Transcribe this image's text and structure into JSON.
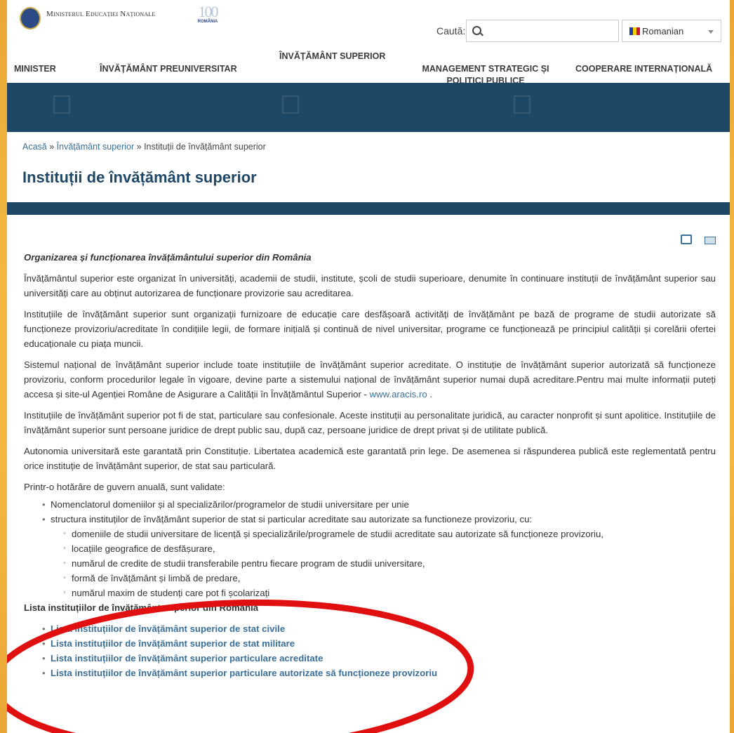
{
  "header": {
    "ministry_name": "Ministerul Educației Naționale",
    "centenary_number": "100",
    "centenary_text": "ROMÂNIA",
    "search_label": "Caută:",
    "search_value": "",
    "language": "Romanian"
  },
  "nav": {
    "items": [
      {
        "label": "MINISTER"
      },
      {
        "label": "ÎNVĂȚĂMÂNT PREUNIVERSITAR"
      },
      {
        "label": "ÎNVĂȚĂMÂNT SUPERIOR"
      },
      {
        "label": "MANAGEMENT STRATEGIC ȘI POLITICI PUBLICE"
      },
      {
        "label": "COOPERARE INTERNAȚIONALĂ"
      }
    ]
  },
  "breadcrumb": {
    "home": "Acasă",
    "separator": "»",
    "section": "Învățământ superior",
    "current": "Instituții de învățământ superior"
  },
  "page_title": "Instituții de învățământ superior",
  "tools": {
    "print_icon": "print-icon",
    "email_icon": "email-icon"
  },
  "content": {
    "intro_heading": "Organizarea și funcționarea învățământului superior din România",
    "p1": "Învățământul superior este organizat în universități, academii de studii, institute, școli de studii superioare, denumite în continuare instituții de învățământ superior sau universități care au obținut autorizarea de funcționare provizorie sau acreditarea.",
    "p2": "Instituțiile de învățământ superior sunt organizații furnizoare de educație care desfășoară activități de învățământ pe bază de programe de studii autorizate să funcționeze provizoriu/acreditate în condițiile legii, de formare inițială și continuă de nivel universitar, programe ce funcționează pe principiul calității și corelării ofertei educaționale cu piața muncii.",
    "p3_text": "Sistemul național de învățământ superior include toate instituțiile de învățământ superior acreditate. O instituție de învățământ superior autorizată să funcționeze provizoriu, conform procedurilor legale în vigoare, devine parte a sistemului național de învățământ superior numai după acreditare.Pentru mai multe informații puteți accesa și site-ul Agenției Române de Asigurare a Calității în Învățământul Superior - ",
    "p3_link": "www.aracis.ro",
    "p3_end": " .",
    "p4": "Instituțiile de învățământ superior pot fi de stat, particulare sau confesionale. Aceste instituții au personalitate juridică, au caracter nonprofit și sunt apolitice. Instituțiile de învățământ superior sunt persoane juridice de drept public sau, după caz, persoane juridice de drept privat și de utilitate publică.",
    "p5": "Autonomia universitară este garantată prin Constituție. Libertatea academică este garantată prin lege. De asemenea si răspunderea publică este reglementată pentru orice instituție de învățământ superior, de stat sau particulară.",
    "p6": "Printr-o hotărâre de guvern anuală, sunt validate:",
    "list": {
      "item1": "Nomenclatorul domeniilor și al specializărilor/programelor de studii universitare per unie",
      "item2": "structura instituților de învățământ superior de stat si particular acreditate sau autorizate sa functioneze provizoriu, cu:",
      "sub": [
        "domeniile de studii universitare de licență și specializările/programele de studii acreditate sau autorizate să funcționeze provizoriu,",
        "locațiile geografice de desfășurare,",
        "numărul de credite de studii transferabile pentru fiecare program de studii universitare,",
        "formă de învățământ și limbă de predare,",
        "numărul maxim de studenți care pot fi școlarizați"
      ]
    },
    "list_heading": "Lista instituțiilor de învățământ superior din România",
    "links": [
      "Lista instituțiilor de învățământ superior de stat civile",
      "Lista instituțiilor de învățământ superior de stat militare",
      "Lista instituțiilor de învățământ superior particulare acreditate",
      "Lista instituțiilor de învățământ superior particulare autorizate să funcționeze provizoriu"
    ]
  },
  "colors": {
    "accent": "#1f4766",
    "link": "#3a6f98",
    "annotation": "#e01010",
    "frame": "#f5bf45"
  }
}
